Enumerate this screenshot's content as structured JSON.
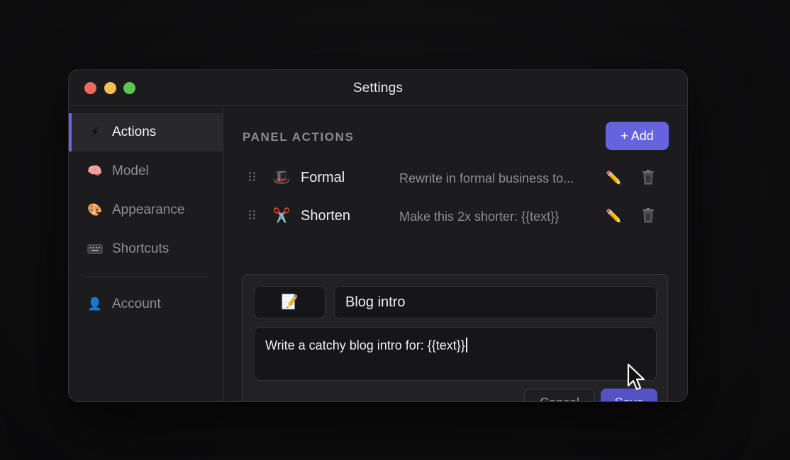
{
  "window": {
    "title": "Settings"
  },
  "sidebar": {
    "items": [
      {
        "icon": "lightning-icon",
        "glyph": "⚡",
        "label": "Actions",
        "active": true
      },
      {
        "icon": "brain-icon",
        "glyph": "🧠",
        "label": "Model",
        "active": false
      },
      {
        "icon": "palette-icon",
        "glyph": "🎨",
        "label": "Appearance",
        "active": false
      },
      {
        "icon": "keyboard-icon",
        "glyph": "⌨",
        "label": "Shortcuts",
        "active": false
      },
      {
        "icon": "person-icon",
        "glyph": "👤",
        "label": "Account",
        "active": false
      }
    ]
  },
  "main": {
    "section_title": "PANEL ACTIONS",
    "add_label": "+ Add",
    "actions": [
      {
        "emoji": "🎩",
        "icon": "top-hat-icon",
        "name": "Formal",
        "prompt": "Rewrite in formal business to..."
      },
      {
        "emoji": "✂️",
        "icon": "scissors-icon",
        "name": "Shorten",
        "prompt": "Make this 2x shorter: {{text}}"
      }
    ],
    "editor": {
      "emoji": "📝",
      "emoji_icon": "memo-icon",
      "name_value": "Blog intro",
      "prompt_value": "Write a catchy blog intro for: {{text}}",
      "cancel_label": "Cancel",
      "save_label": "Save"
    }
  },
  "colors": {
    "accent": "#6663e0",
    "window_bg": "#1c1c1e",
    "page_bg": "#0d0d0e"
  }
}
